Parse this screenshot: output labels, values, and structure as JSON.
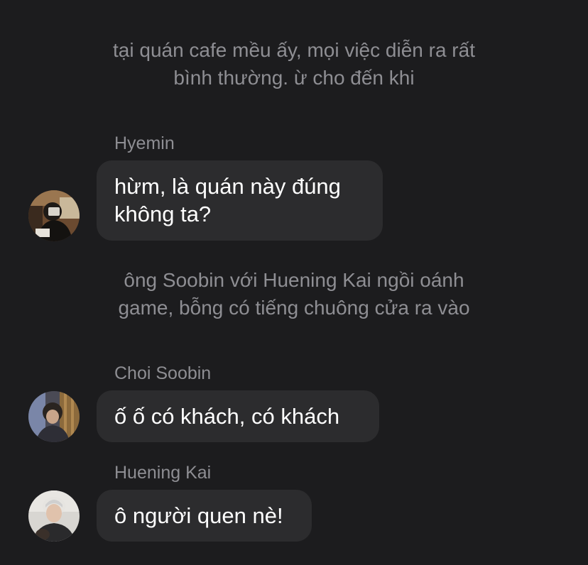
{
  "narrations": [
    {
      "lines": [
        "tại quán cafe mều ấy, mọi việc diễn ra rất",
        "bình thường. ừ cho đến khi"
      ]
    },
    {
      "lines": [
        "ông Soobin với Huening Kai ngồi oánh",
        "game, bỗng có tiếng chuông cửa ra vào"
      ]
    }
  ],
  "messages": [
    {
      "sender": "Hyemin",
      "lines": [
        "hừm, là quán này đúng",
        "không ta?"
      ],
      "avatar_icon": "avatar-hyemin"
    },
    {
      "sender": "Choi Soobin",
      "lines": [
        "ố ố có khách, có khách"
      ],
      "avatar_icon": "avatar-soobin"
    },
    {
      "sender": "Huening Kai",
      "lines": [
        "ô người quen nè!"
      ],
      "avatar_icon": "avatar-huening-kai"
    }
  ],
  "colors": {
    "background": "#1c1c1e",
    "bubble": "#2c2c2e",
    "secondary_text": "#8e8e93",
    "primary_text": "#ffffff"
  }
}
